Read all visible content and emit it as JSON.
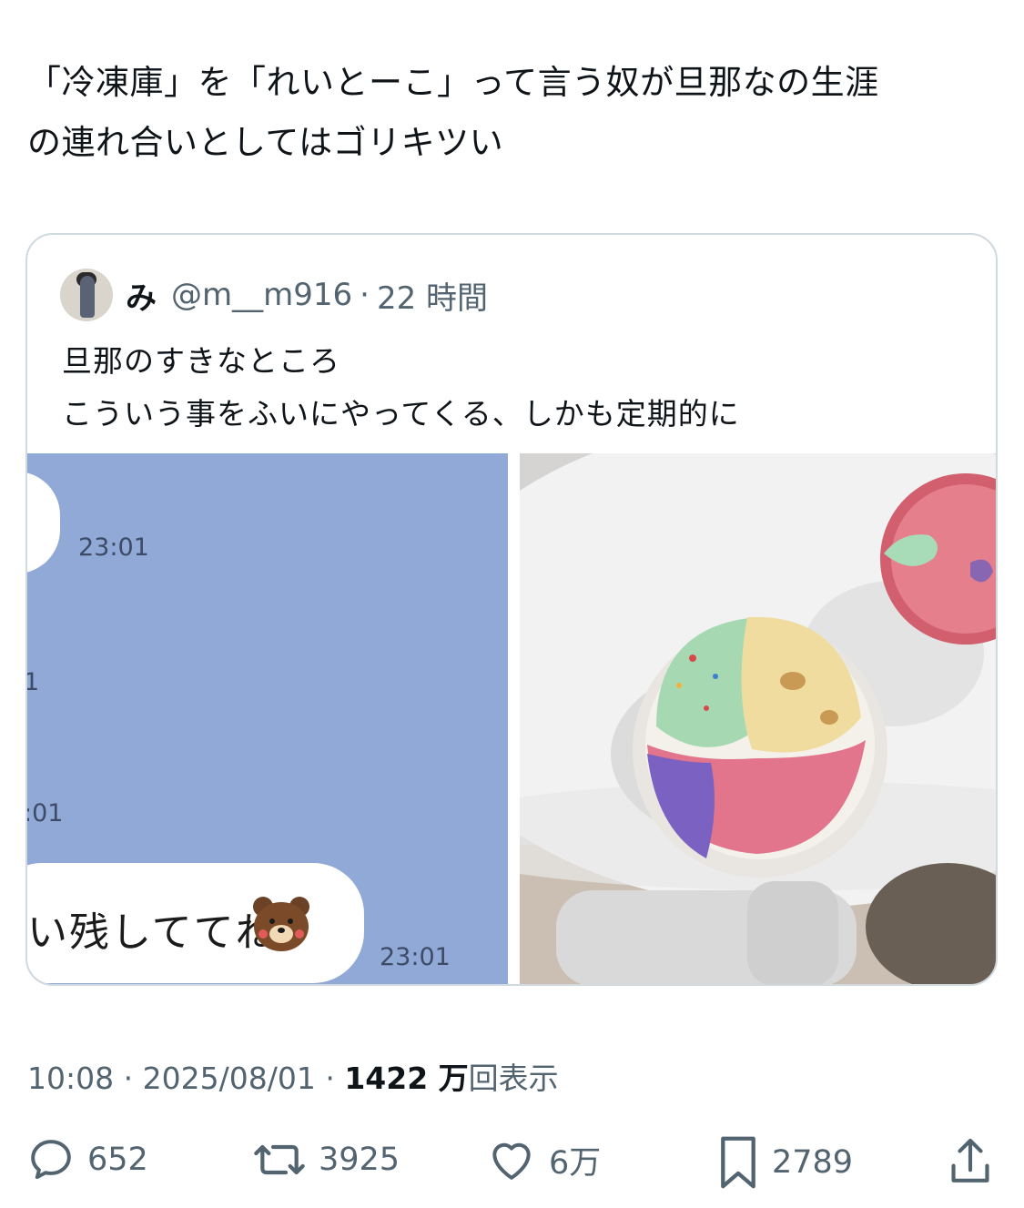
{
  "tweet": {
    "text_line1": "「冷凍庫」を「れいとーこ」って言う奴が旦那なの生涯",
    "text_line2": "の連れ合いとしてはゴリキツい"
  },
  "quote": {
    "name": "み",
    "handle": "@m__m916",
    "separator": "·",
    "time": "22 時間",
    "text_line1": "旦那のすきなところ",
    "text_line2": "こういう事をふいにやってくる、しかも定期的に"
  },
  "chat_screenshot": {
    "time_1": "23:01",
    "time_2": "1",
    "time_3": ":01",
    "message": "い残しててね",
    "time_4": "23:01",
    "background": "#90a9d6",
    "sticker_icon": "bear-sticker-icon"
  },
  "photo": {
    "icon": "ice-cream-photo"
  },
  "meta": {
    "time": "10:08",
    "sep1": "·",
    "date": "2025/08/01",
    "sep2": "·",
    "views_count": "1422 万",
    "views_label": "回表示"
  },
  "actions": {
    "replies": "652",
    "reposts": "3925",
    "likes": "6万",
    "bookmarks": "2789",
    "reply_icon": "reply-icon",
    "repost_icon": "repost-icon",
    "like_icon": "heart-icon",
    "bookmark_icon": "bookmark-icon",
    "share_icon": "share-icon"
  },
  "colors": {
    "text": "#0f1419",
    "secondary": "#536471",
    "border": "#cfd9de"
  }
}
